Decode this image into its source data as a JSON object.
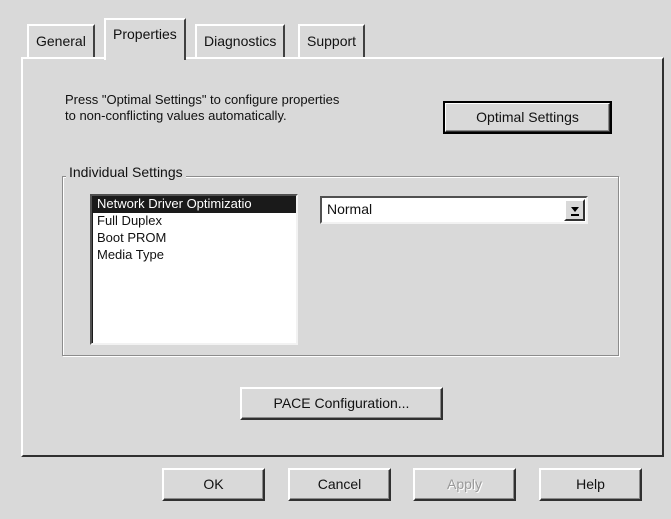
{
  "tabs": [
    {
      "label": "General",
      "selected": false
    },
    {
      "label": "Properties",
      "selected": true
    },
    {
      "label": "Diagnostics",
      "selected": false
    },
    {
      "label": "Support",
      "selected": false
    }
  ],
  "properties": {
    "description_line1": "Press \"Optimal Settings\" to configure properties",
    "description_line2": "to non-conflicting values automatically.",
    "optimal_button_label": "Optimal Settings",
    "group_label": "Individual Settings",
    "list_items": [
      "Network Driver Optimizatio",
      "Full Duplex",
      "Boot PROM",
      "Media Type"
    ],
    "selected_item_index": 0,
    "value_selected": "Normal",
    "pace_button_label": "PACE Configuration..."
  },
  "footer": {
    "ok_label": "OK",
    "cancel_label": "Cancel",
    "apply_label": "Apply",
    "help_label": "Help"
  },
  "icons": {
    "dropdown": "dropdown-arrow-icon"
  },
  "colors": {
    "face": "#d9d9d9",
    "selection": "#1a1a1a"
  }
}
